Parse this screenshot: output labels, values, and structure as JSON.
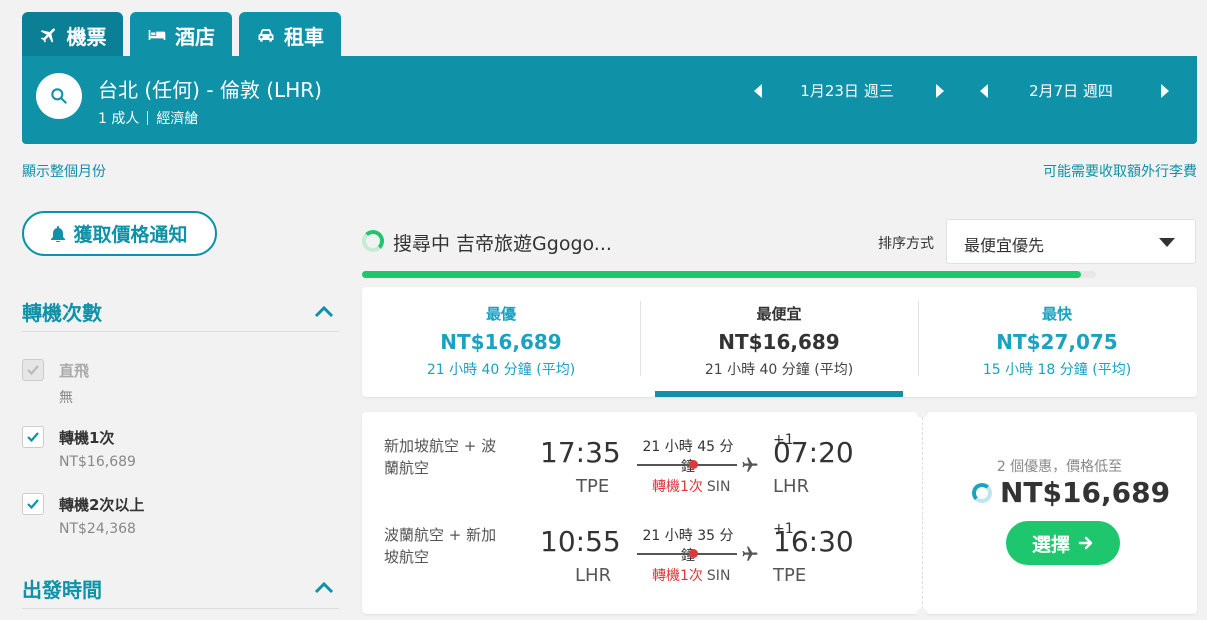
{
  "tabs": [
    {
      "label": "機票",
      "icon": "plane-icon",
      "active": true
    },
    {
      "label": "酒店",
      "icon": "bed-icon",
      "active": false
    },
    {
      "label": "租車",
      "icon": "car-icon",
      "active": false
    }
  ],
  "search": {
    "route": "台北 (任何) - 倫敦 (LHR)",
    "passengers": "1 成人",
    "cabin": "經濟艙",
    "depart_date": "1月23日 週三",
    "return_date": "2月7日 週四"
  },
  "links": {
    "show_month": "顯示整個月份",
    "baggage_fee": "可能需要收取額外行李費"
  },
  "sidebar": {
    "price_alert": "獲取價格通知",
    "stops_title": "轉機次數",
    "stop_options": [
      {
        "label": "直飛",
        "sub": "無",
        "checked": true,
        "disabled": true
      },
      {
        "label": "轉機1次",
        "sub": "NT$16,689",
        "checked": true,
        "disabled": false
      },
      {
        "label": "轉機2次以上",
        "sub": "NT$24,368",
        "checked": true,
        "disabled": false
      }
    ],
    "departure_title": "出發時間"
  },
  "results": {
    "searching_text": "搜尋中 吉帝旅遊Ggogo...",
    "sort_label": "排序方式",
    "sort_value": "最便宜優先",
    "progress": 0.98,
    "summary": [
      {
        "title": "最優",
        "price": "NT$16,689",
        "duration": "21 小時 40 分鐘 (平均)"
      },
      {
        "title": "最便宜",
        "price": "NT$16,689",
        "duration": "21 小時 40 分鐘 (平均)"
      },
      {
        "title": "最快",
        "price": "NT$27,075",
        "duration": "15 小時 18 分鐘 (平均)"
      }
    ],
    "active_summary": 1
  },
  "card": {
    "legs": [
      {
        "airline": "新加坡航空 + 波蘭航空",
        "dep_time": "17:35",
        "dep_code": "TPE",
        "duration": "21 小時 45 分鐘",
        "stops": "轉機1次",
        "via": "SIN",
        "arr_time": "07:20",
        "arr_plus": "+1",
        "arr_code": "LHR"
      },
      {
        "airline": "波蘭航空 + 新加坡航空",
        "dep_time": "10:55",
        "dep_code": "LHR",
        "duration": "21 小時 35 分鐘",
        "stops": "轉機1次",
        "via": "SIN",
        "arr_time": "16:30",
        "arr_plus": "+1",
        "arr_code": "TPE"
      }
    ],
    "deals_text": "2 個優惠，價格低至",
    "price": "NT$16,689",
    "select_label": "選擇"
  },
  "colors": {
    "primary": "#0f91a8",
    "accent_green": "#1ec66e",
    "stop_red": "#e0373b"
  }
}
